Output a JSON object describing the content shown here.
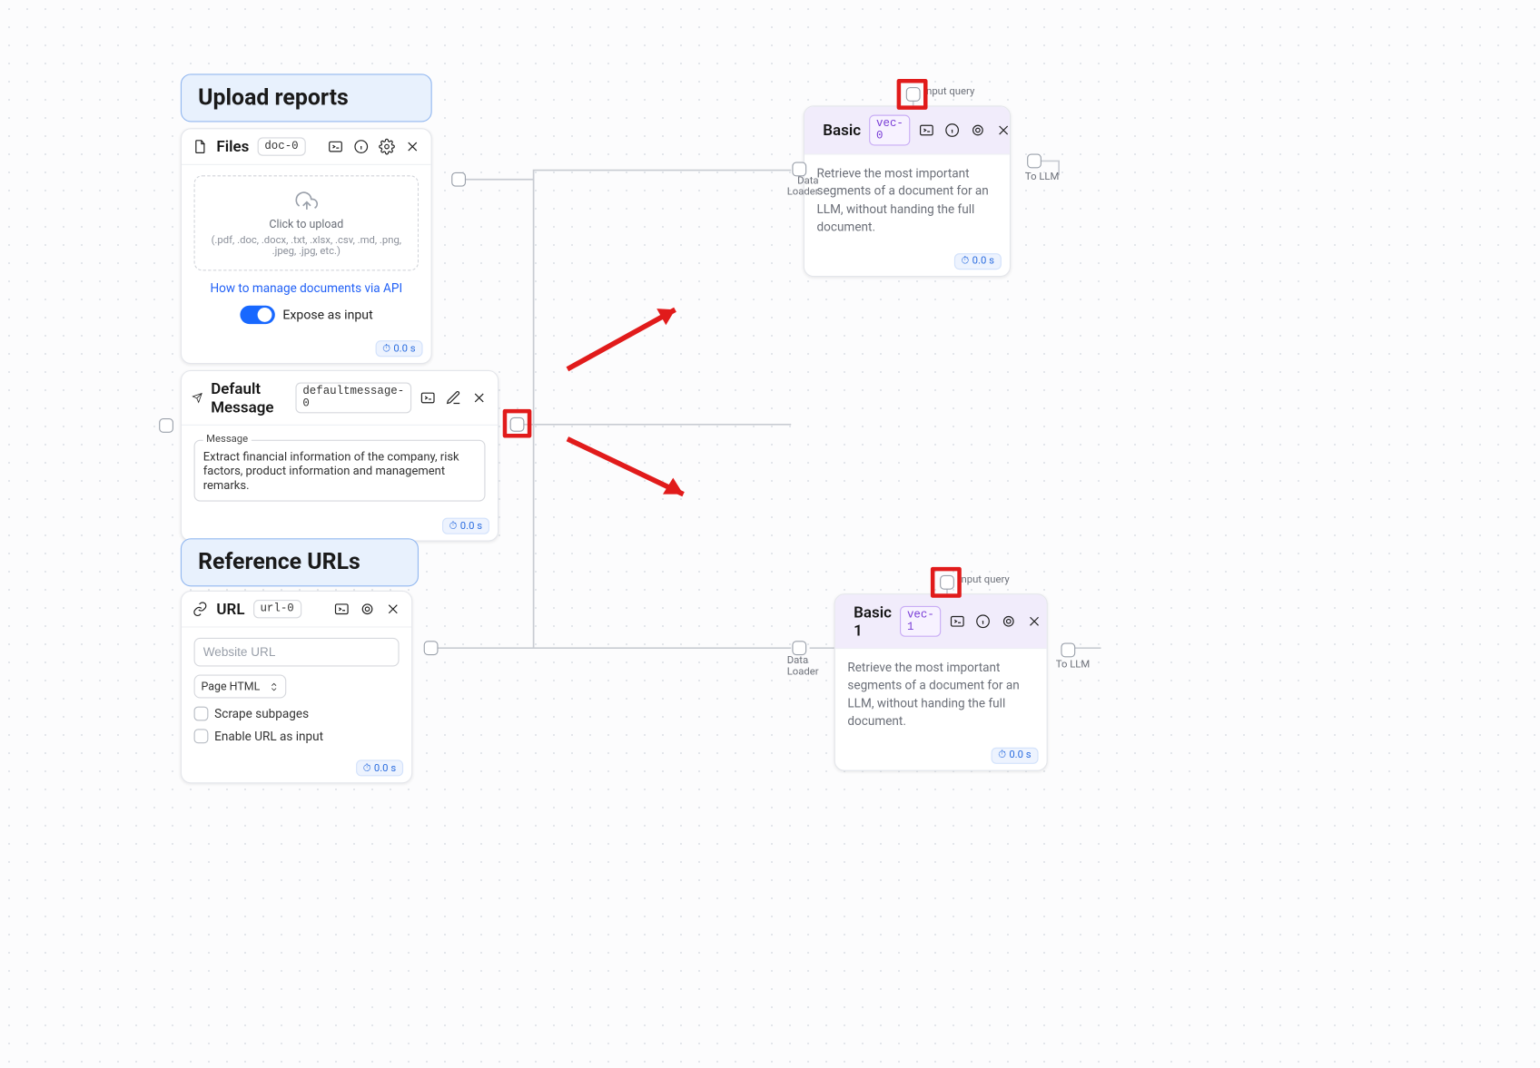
{
  "groups": {
    "upload_reports": "Upload reports",
    "reference_urls": "Reference URLs"
  },
  "nodes": {
    "files": {
      "title": "Files",
      "id": "doc-0",
      "click_to_upload": "Click to upload",
      "formats": "(.pdf, .doc, .docx, .txt, .xlsx, .csv, .md, .png, .jpeg, .jpg, etc.)",
      "manage_link": "How to manage documents via API",
      "expose_label": "Expose as input",
      "timing": "0.0 s"
    },
    "default_message": {
      "title": "Default Message",
      "id": "defaultmessage-0",
      "msg_label": "Message",
      "msg_text": "Extract financial information of the company, risk factors, product information and management remarks.",
      "timing": "0.0 s"
    },
    "url": {
      "title": "URL",
      "id": "url-0",
      "placeholder": "Website URL",
      "select_value": "Page HTML",
      "scrape_label": "Scrape subpages",
      "enable_label": "Enable URL as input",
      "timing": "0.0 s"
    },
    "basic0": {
      "title": "Basic",
      "id": "vec-0",
      "desc": "Retrieve the most important segments of a document for an LLM, without handing the full document.",
      "timing": "0.0 s"
    },
    "basic1": {
      "title": "Basic 1",
      "id": "vec-1",
      "desc": "Retrieve the most important segments of a document for an LLM, without handing the full document.",
      "timing": "0.0 s"
    }
  },
  "ports": {
    "data_loader": "Data\nLoader",
    "input_query": "Input query",
    "to_llm": "To LLM"
  }
}
